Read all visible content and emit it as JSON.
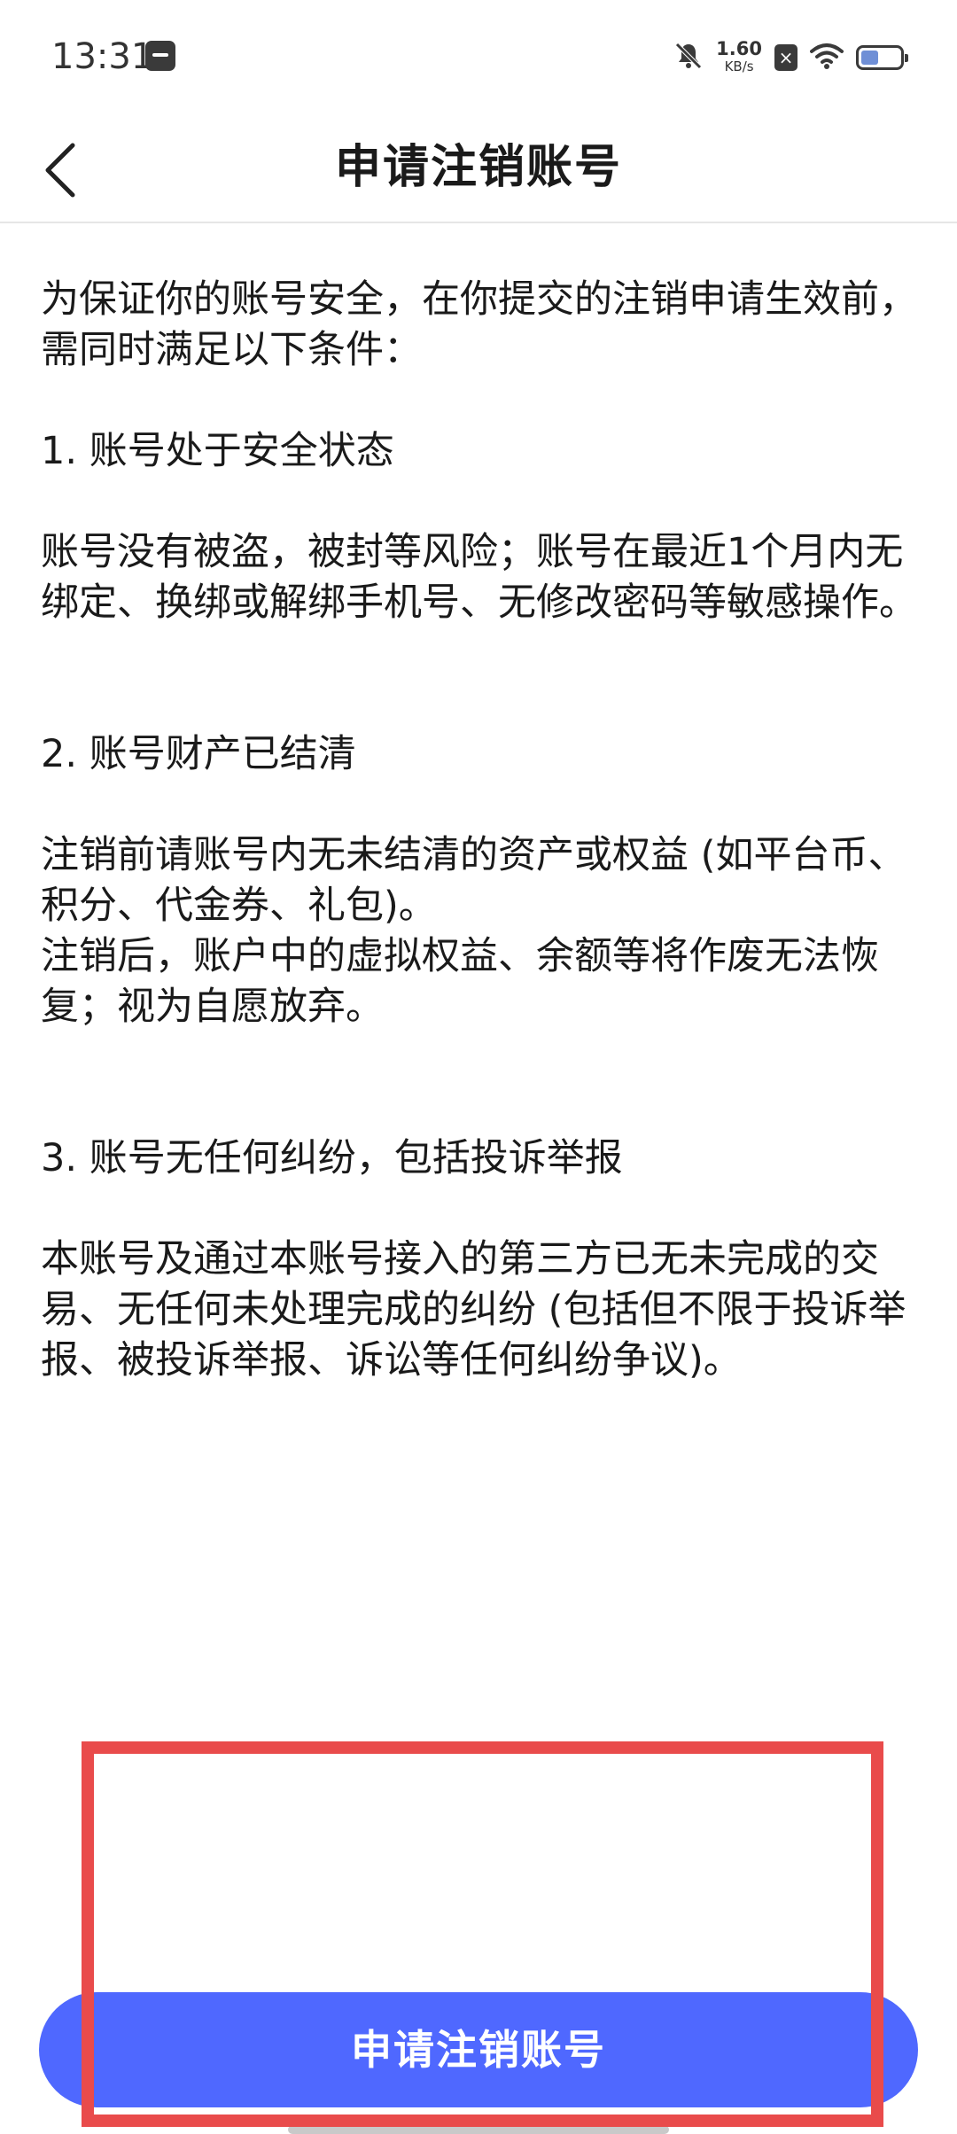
{
  "status_bar": {
    "time": "13:31",
    "net_speed_value": "1.60",
    "net_speed_unit": "KB/s",
    "icons": [
      "calendar-icon",
      "mute-icon",
      "no-sim-icon",
      "wifi-icon",
      "battery-icon"
    ],
    "battery_level": 0.45
  },
  "header": {
    "back_icon": "chevron-left-icon",
    "title": "申请注销账号"
  },
  "content": {
    "intro": "为保证你的账号安全，在你提交的注销申请生效前，需同时满足以下条件：",
    "sections": [
      {
        "heading": "1. 账号处于安全状态",
        "body": "账号没有被盗，被封等风险；账号在最近1个月内无绑定、换绑或解绑手机号、无修改密码等敏感操作。"
      },
      {
        "heading": "2. 账号财产已结清",
        "body": "注销前请账号内无未结清的资产或权益 (如平台币、积分、代金券、礼包)。\n注销后，账户中的虚拟权益、余额等将作废无法恢复；视为自愿放弃。"
      },
      {
        "heading": "3. 账号无任何纠纷，包括投诉举报",
        "body": "本账号及通过本账号接入的第三方已无未完成的交易、无任何未处理完成的纠纷 (包括但不限于投诉举报、被投诉举报、诉讼等任何纠纷争议)。"
      }
    ]
  },
  "footer": {
    "apply_label": "申请注销账号"
  },
  "colors": {
    "primary_button": "#4f68ff",
    "highlight_border": "#e94b4b",
    "text": "#1a1a1a"
  }
}
